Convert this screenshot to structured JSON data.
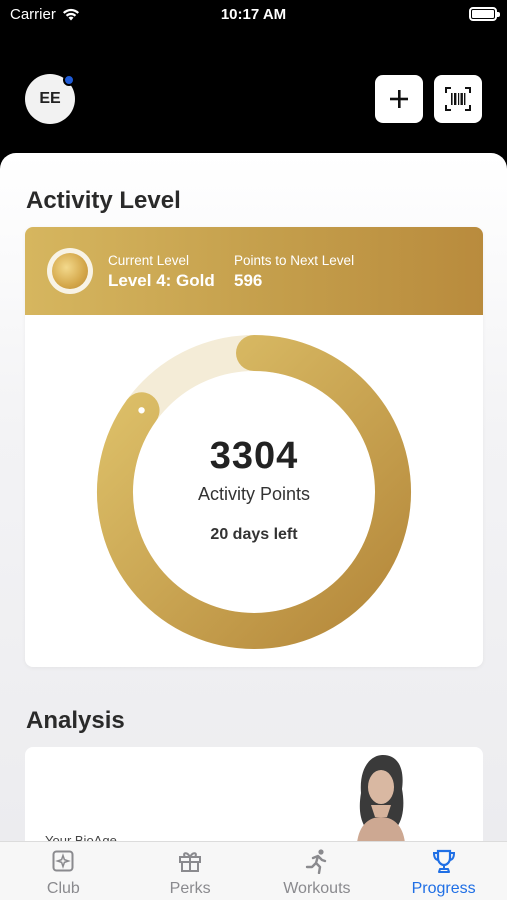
{
  "status_bar": {
    "carrier": "Carrier",
    "time": "10:17 AM"
  },
  "header": {
    "avatar_initials": "EE"
  },
  "activity": {
    "section_title": "Activity Level",
    "current_level_label": "Current Level",
    "current_level_value": "Level 4: Gold",
    "next_level_label": "Points to Next Level",
    "next_level_value": "596",
    "points": "3304",
    "points_label": "Activity Points",
    "days_left": "20 days left",
    "progress_fraction": 0.85
  },
  "analysis": {
    "section_title": "Analysis",
    "bioage_label": "Your BioAge"
  },
  "tabs": [
    {
      "label": "Club",
      "icon": "club-icon"
    },
    {
      "label": "Perks",
      "icon": "gift-icon"
    },
    {
      "label": "Workouts",
      "icon": "runner-icon"
    },
    {
      "label": "Progress",
      "icon": "trophy-icon",
      "active": true
    }
  ],
  "colors": {
    "gold_light": "#dcc06a",
    "gold_dark": "#b9893a",
    "ring_track": "#f4ecd7",
    "accent": "#1f6fe5"
  }
}
